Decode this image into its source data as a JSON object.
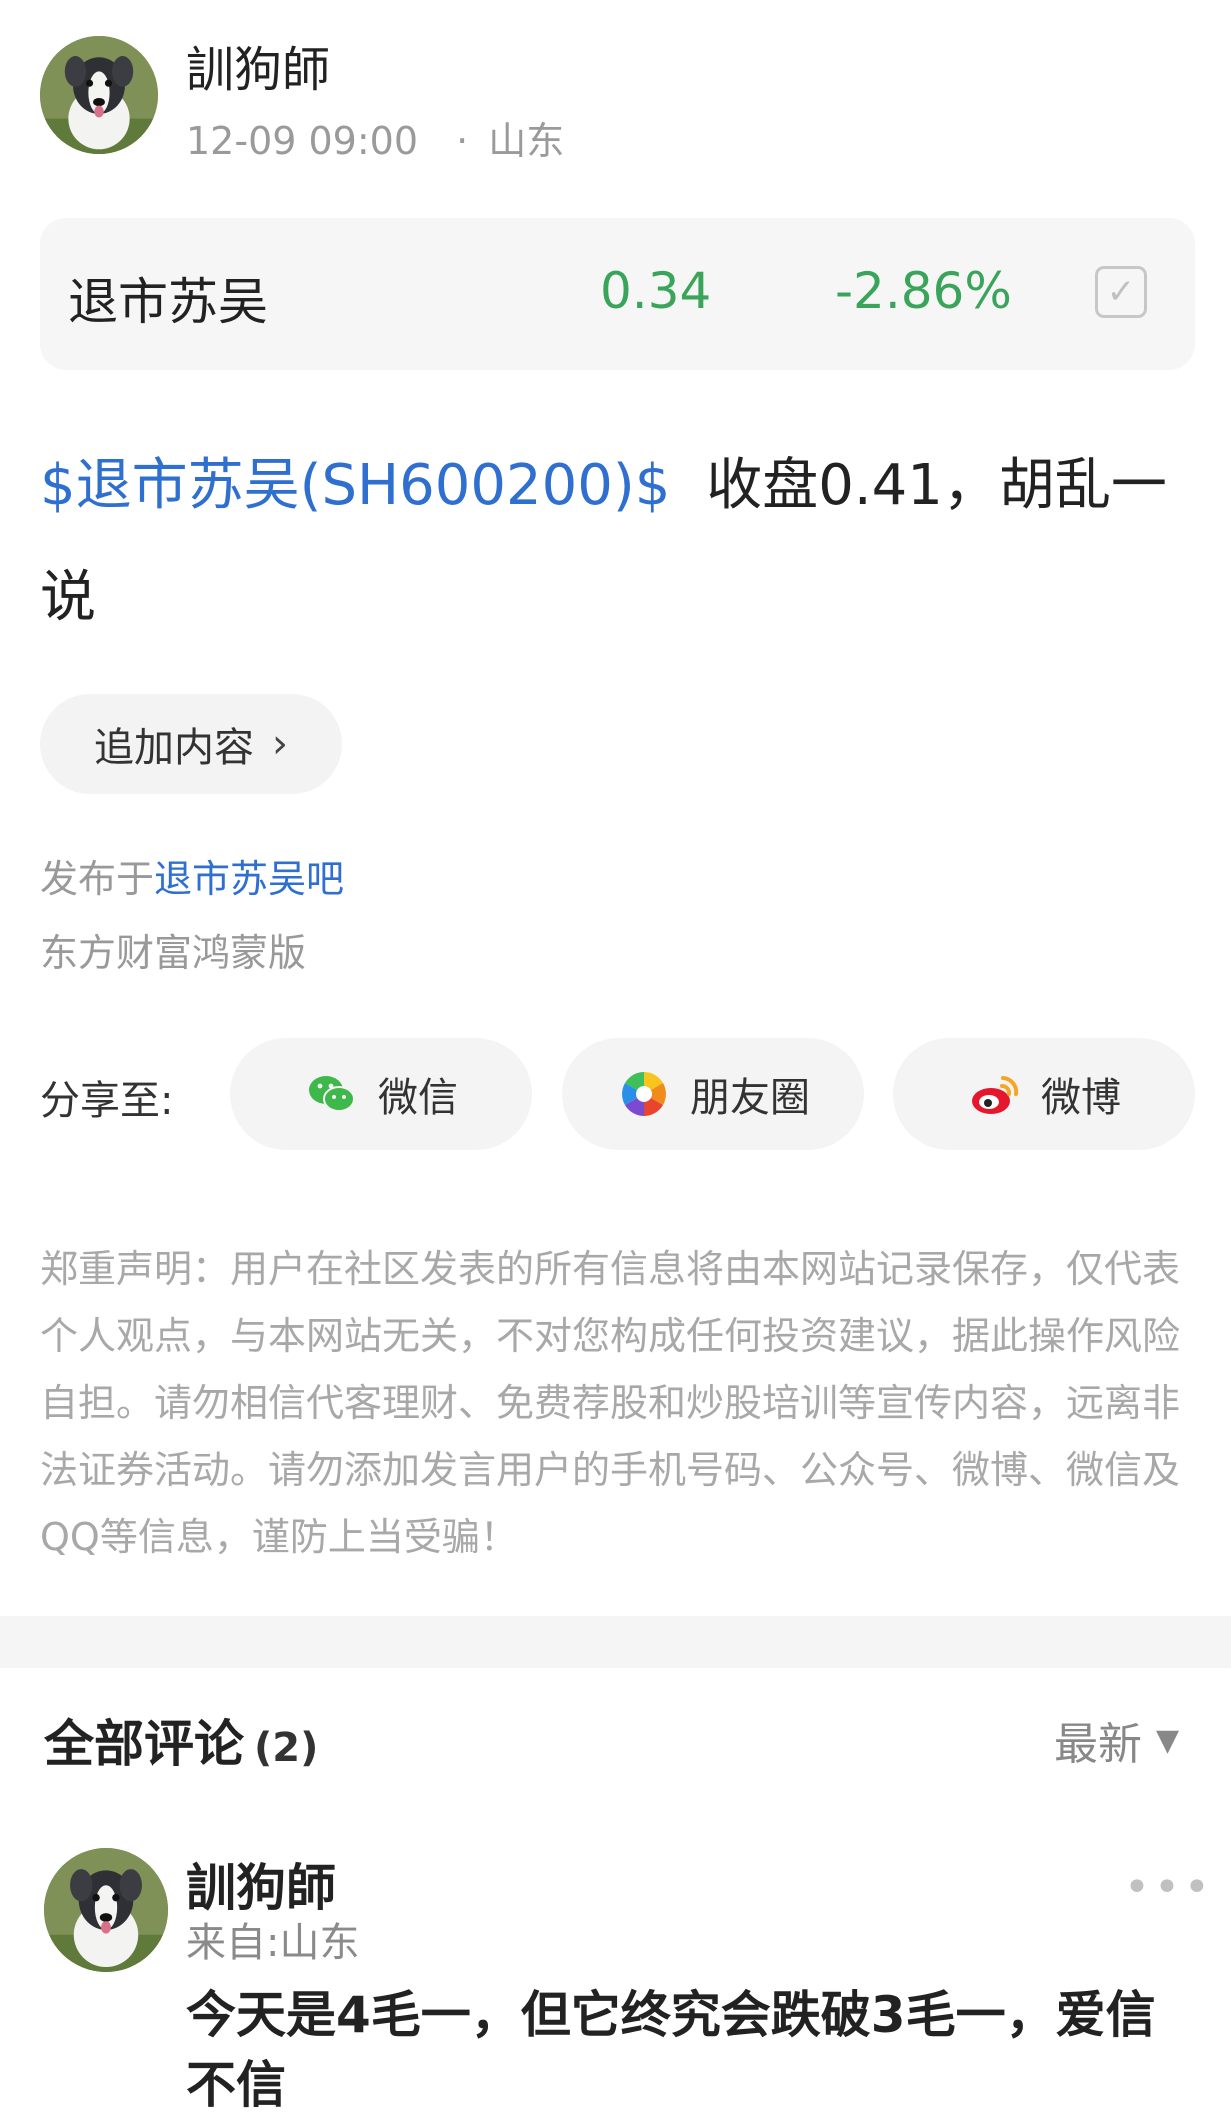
{
  "post": {
    "author": "訓狗師",
    "time": "12-09 09:00",
    "location_sep": "·",
    "location": "山东"
  },
  "stock": {
    "name": "退市苏吴",
    "price": "0.34",
    "change": "-2.86%",
    "check_icon": "check-icon"
  },
  "content": {
    "tag": "$退市苏吴(SH600200)$",
    "text": "收盘0.41，胡乱一说"
  },
  "append_button": {
    "label": "追加内容",
    "chevron": "›"
  },
  "publish": {
    "prefix": "发布于",
    "board": "退市苏吴吧"
  },
  "client": "东方财富鸿蒙版",
  "share": {
    "label": "分享至:",
    "wechat": "微信",
    "moments": "朋友圈",
    "weibo": "微博"
  },
  "disclaimer": "郑重声明：用户在社区发表的所有信息将由本网站记录保存，仅代表个人观点，与本网站无关，不对您构成任何投资建议，据此操作风险自担。请勿相信代客理财、免费荐股和炒股培训等宣传内容，远离非法证券活动。请勿添加发言用户的手机号码、公众号、微博、微信及QQ等信息，谨防上当受骗！",
  "comments": {
    "title": "全部评论",
    "count": "(2)",
    "sort_label": "最新",
    "sort_icon": "▼",
    "items": [
      {
        "author": "訓狗師",
        "location": "来自:山东",
        "more": "•••",
        "text": "今天是4毛一，但它终究会跌破3毛一，爱信不信"
      }
    ]
  },
  "colors": {
    "stock_down": "#3aa55a",
    "link": "#2f6fd0"
  }
}
